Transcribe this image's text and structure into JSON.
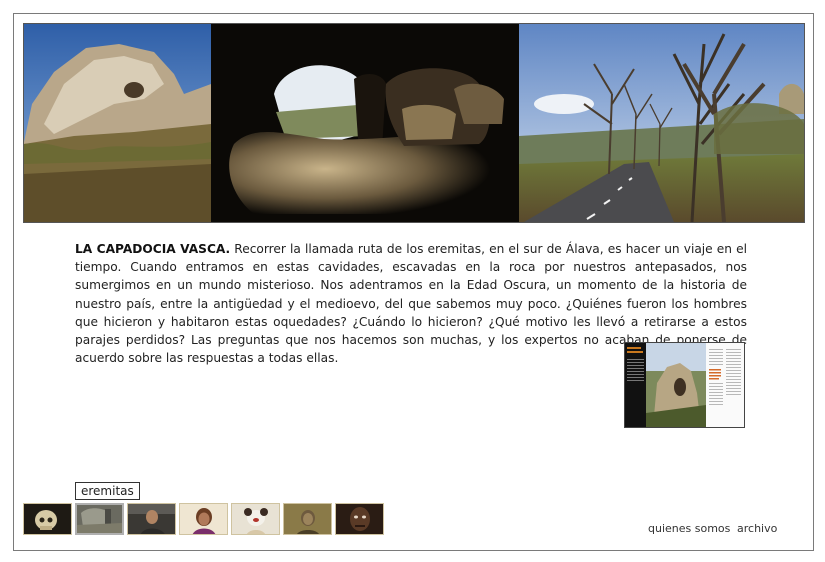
{
  "article": {
    "heading": "LA CAPADOCIA VASCA.",
    "body": " Recorrer la llamada ruta de los eremitas, en el sur de Álava, es hacer un viaje en el tiempo. Cuando entramos en estas cavidades, escavadas en la roca por nuestros antepasados, nos sumergimos en un mundo misterioso. Nos adentramos en la Edad Oscura, un momento de la historia de nuestro país, entre la antigüedad y el medioevo, del que sabemos muy poco. ¿Quiénes fueron los hombres que hicieron y habitaron estas oquedades? ¿Cuándo lo hicieron? ¿Qué motivo les llevó a retirarse a estos parajes perdidos? Las preguntas que nos hacemos son muchas, y los expertos no acaban de ponerse de acuerdo sobre las respuestas a todas ellas."
  },
  "gallery": {
    "label": "eremitas",
    "thumbnails": [
      {
        "subject": "skull"
      },
      {
        "subject": "cave-interior",
        "active": true
      },
      {
        "subject": "man-portrait"
      },
      {
        "subject": "girl-portrait"
      },
      {
        "subject": "plush-toy"
      },
      {
        "subject": "old-man-portrait"
      },
      {
        "subject": "dark-portrait"
      }
    ]
  },
  "footer": {
    "about_label": "quienes somos",
    "archive_label": "archivo"
  },
  "colors": {
    "frame": "#7a7a7a",
    "thumb_border": "#cfc3a0",
    "text": "#222222"
  }
}
